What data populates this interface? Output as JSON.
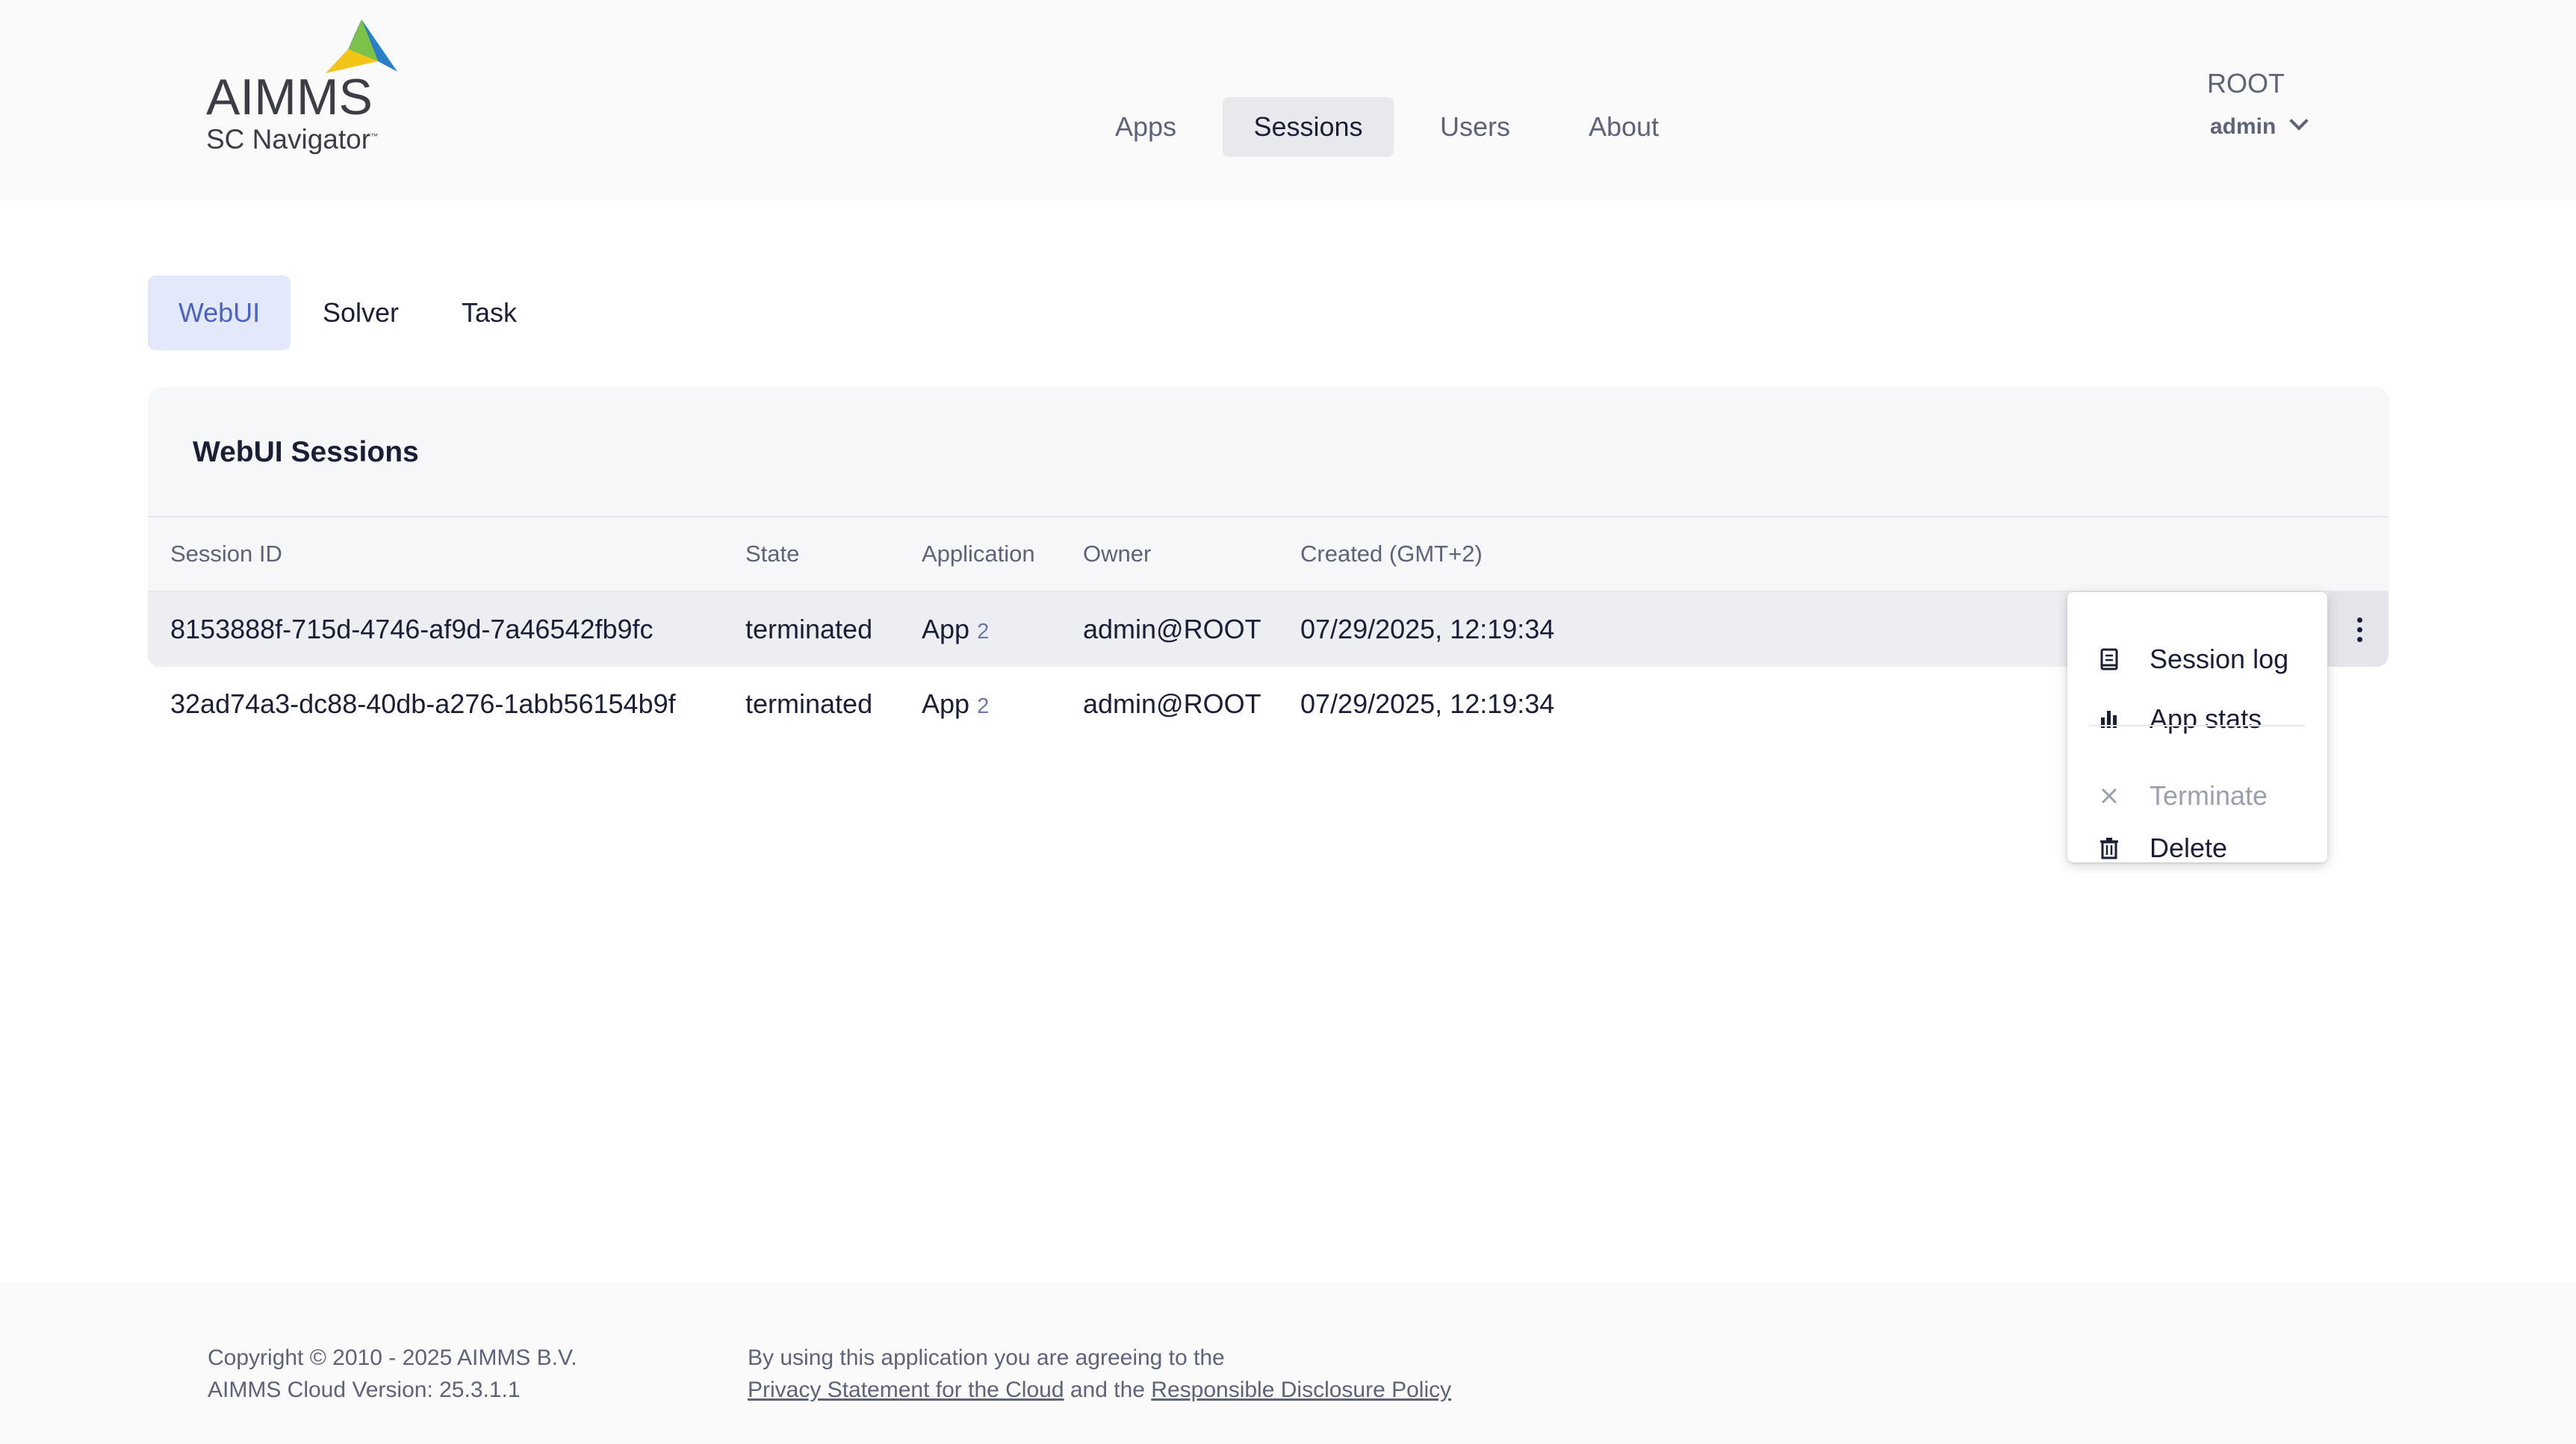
{
  "header": {
    "logo": {
      "title": "AIMMS",
      "subtitle": "SC Navigator",
      "trademark": "™"
    },
    "nav": [
      {
        "label": "Apps",
        "active": false
      },
      {
        "label": "Sessions",
        "active": true
      },
      {
        "label": "Users",
        "active": false
      },
      {
        "label": "About",
        "active": false
      }
    ],
    "account": {
      "org": "ROOT",
      "user": "admin"
    }
  },
  "tabs": [
    {
      "label": "WebUI",
      "active": true
    },
    {
      "label": "Solver",
      "active": false
    },
    {
      "label": "Task",
      "active": false
    }
  ],
  "sessions": {
    "title": "WebUI Sessions",
    "columns": [
      "Session ID",
      "State",
      "Application",
      "Owner",
      "Created (GMT+2)"
    ],
    "rows": [
      {
        "id": "8153888f-715d-4746-af9d-7a46542fb9fc",
        "state": "terminated",
        "app": "App",
        "app_version": "2",
        "owner": "admin@ROOT",
        "created": "07/29/2025, 12:19:34"
      },
      {
        "id": "32ad74a3-dc88-40db-a276-1abb56154b9f",
        "state": "terminated",
        "app": "App",
        "app_version": "2",
        "owner": "admin@ROOT",
        "created": "07/29/2025, 12:19:34"
      }
    ]
  },
  "context_menu": {
    "items": [
      {
        "label": "Session log",
        "icon": "log-icon",
        "disabled": false
      },
      {
        "label": "App stats",
        "icon": "bar-chart-icon",
        "disabled": false
      },
      {
        "label": "Terminate",
        "icon": "close-icon",
        "disabled": true
      },
      {
        "label": "Delete",
        "icon": "trash-icon",
        "disabled": false
      }
    ]
  },
  "footer": {
    "copyright": "Copyright © 2010 - 2025 AIMMS B.V.",
    "version": "AIMMS Cloud Version: 25.3.1.1",
    "agree_text": "By using this application you are agreeing to the",
    "privacy_link": "Privacy Statement for the Cloud",
    "and_text": " and the ",
    "disclosure_link": "Responsible Disclosure Policy"
  },
  "colors": {
    "accent": "#4a63c4",
    "tab_active_bg": "#e3e8fa",
    "nav_active_bg": "#e8e9ed",
    "text_primary": "#1a1f36",
    "text_secondary": "#5d6478"
  }
}
